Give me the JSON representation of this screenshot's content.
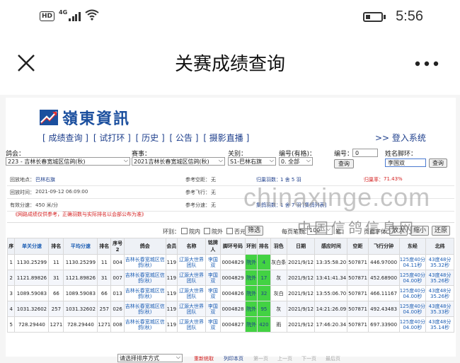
{
  "status_bar": {
    "hd": "HD",
    "network": "4G",
    "time": "5:56"
  },
  "nav": {
    "title": "关赛成绩查询",
    "close_icon": "close-icon",
    "more_icon": "more-icon"
  },
  "site": {
    "logo_text": "嶺東資訊",
    "menu": [
      "[ 成绩查询 ]",
      "[ 试打环 ]",
      "[ 历史 ]",
      "[ 公告 ]",
      "[ 摄影直播 ]"
    ],
    "login": ">> 登入系统"
  },
  "filters": {
    "club_label": "鸽会：",
    "club_value": "223 - 吉林长春宽城区信鸽(秋)",
    "race_label": "赛事：",
    "race_value": "2021吉林长春宽城区信鸽(秋)",
    "rel_label": "关别：",
    "rel_value": "S1-巴林右旗",
    "num_label": "编号(有格)：",
    "num_value": "0. 全部",
    "ring_label": "编号：",
    "ring_value": "0",
    "query1": "查询",
    "name_label": "姓名脚环：",
    "name_value": "李国双",
    "query2": "查询"
  },
  "info": {
    "release_place_l": "回放地点：",
    "release_place": "巴林右旗",
    "release_time_l": "回放时间：",
    "release_time": "2021-09-12 06:09:00",
    "speed_l": "有效分速：",
    "speed": "450 米/分",
    "ref_dist_l": "参考空距：",
    "ref_dist": "无",
    "ref_fly_l": "参考飞行：",
    "ref_fly": "无",
    "ref_speed_l": "参考分速：",
    "ref_speed": "无",
    "returned_l": "归巢羽数：",
    "returned": "1 舍 5 羽",
    "collected_l": "集鸽羽数：",
    "collected": "1 舍 7 羽 [集鸽列表]",
    "rate_l": "归巢率：",
    "rate": "71.43%",
    "notice": "《网路成绩仅供参考，正确羽数与实际排名以会部公布为准》"
  },
  "tools": {
    "ring_label": "环别：",
    "opt1": "院内",
    "opt2": "院外",
    "opt3": "否元",
    "filter_btn": "筛选",
    "per_page_label": "每页笔数：",
    "per_page": "100",
    "per_page_unit": "笔",
    "font_label": "页面字体：",
    "zoom_in": "放大",
    "zoom_out": "缩小",
    "reset": "还原"
  },
  "table": {
    "headers": [
      "序",
      "单关分速",
      "排名",
      "平均分速",
      "排名",
      "序号2",
      "鸽会",
      "会员",
      "名称",
      "铭牌人",
      "脚环号码",
      "环别",
      "排名",
      "羽色",
      "日期",
      "感应时间",
      "空距",
      "飞行分钟",
      "东经",
      "北纬"
    ],
    "rows": [
      [
        "1",
        "1130.25299",
        "11",
        "1130.25299",
        "11",
        "004",
        "吉林长春宽城区信鸽(秋)",
        "119",
        "辽源大世界团队",
        "李国双",
        "0004829",
        "院外",
        "4",
        "灰白条",
        "2021/9/12",
        "13:35:58.20",
        "507871",
        "446.97000",
        "125度40分04.11秒",
        "43度48分35.32秒"
      ],
      [
        "2",
        "1121.89826",
        "31",
        "1121.89826",
        "31",
        "007",
        "吉林长春宽城区信鸽(秋)",
        "119",
        "辽源大世界团队",
        "李国双",
        "0004829",
        "院外",
        "17",
        "灰",
        "2021/9/12",
        "13:41:41.34",
        "507871",
        "452.68900",
        "125度40分04.00秒",
        "43度48分35.26秒"
      ],
      [
        "3",
        "1089.59083",
        "66",
        "1089.59083",
        "66",
        "013",
        "吉林长春宽城区信鸽(秋)",
        "119",
        "辽源大世界团队",
        "李国双",
        "0004826",
        "院外",
        "32",
        "灰白",
        "2021/9/12",
        "13:55:06.70",
        "507871",
        "466.11167",
        "125度40分04.00秒",
        "43度48分35.26秒"
      ],
      [
        "4",
        "1031.32602",
        "257",
        "1031.32602",
        "257",
        "026",
        "吉林长春宽城区信鸽(秋)",
        "119",
        "辽源大世界团队",
        "李国双",
        "0004828",
        "院外",
        "95",
        "灰",
        "2021/9/12",
        "14:21:26.09",
        "507871",
        "492.43483",
        "125度40分04.00秒",
        "43度48分35.33秒"
      ],
      [
        "5",
        "728.29440",
        "1271",
        "728.29440",
        "1271",
        "008",
        "吉林长春宽城区信鸽(秋)",
        "119",
        "辽源大世界团队",
        "李国双",
        "0004827",
        "院外",
        "420",
        "雨",
        "2021/9/12",
        "17:46:20.34",
        "507871",
        "697.33900",
        "125度40分04.00秒",
        "43度48分35.14秒"
      ]
    ]
  },
  "pager": {
    "sort": "请选择排序方式",
    "reset": "重新统取",
    "print": "列印本页",
    "first": "第一页",
    "prev": "上一页",
    "next": "下一页",
    "last": "最后页"
  },
  "watermark": {
    "line1": "chinaxinge.com",
    "line2": "中国信鸽信息网"
  },
  "colors": {
    "accent_blue": "#1e3f8c",
    "highlight_green": "#43d243",
    "alert_red": "#d42020"
  }
}
